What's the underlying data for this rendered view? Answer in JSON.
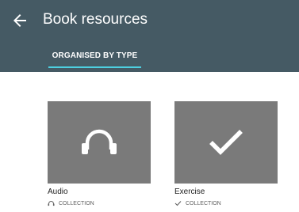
{
  "header": {
    "back_icon": "arrow-left-icon",
    "title": "Book resources",
    "background": "#455a64",
    "tabs": [
      {
        "label": "ORGANISED BY TYPE",
        "selected": true
      }
    ],
    "indicator_color": "#4dd0e1"
  },
  "resources": [
    {
      "title": "Audio",
      "meta_label": "COLLECTION",
      "thumb_icon": "headphones-icon",
      "meta_icon": "headphones-icon"
    },
    {
      "title": "Exercise",
      "meta_label": "COLLECTION",
      "thumb_icon": "checkmark-icon",
      "meta_icon": "checkmark-icon"
    }
  ]
}
